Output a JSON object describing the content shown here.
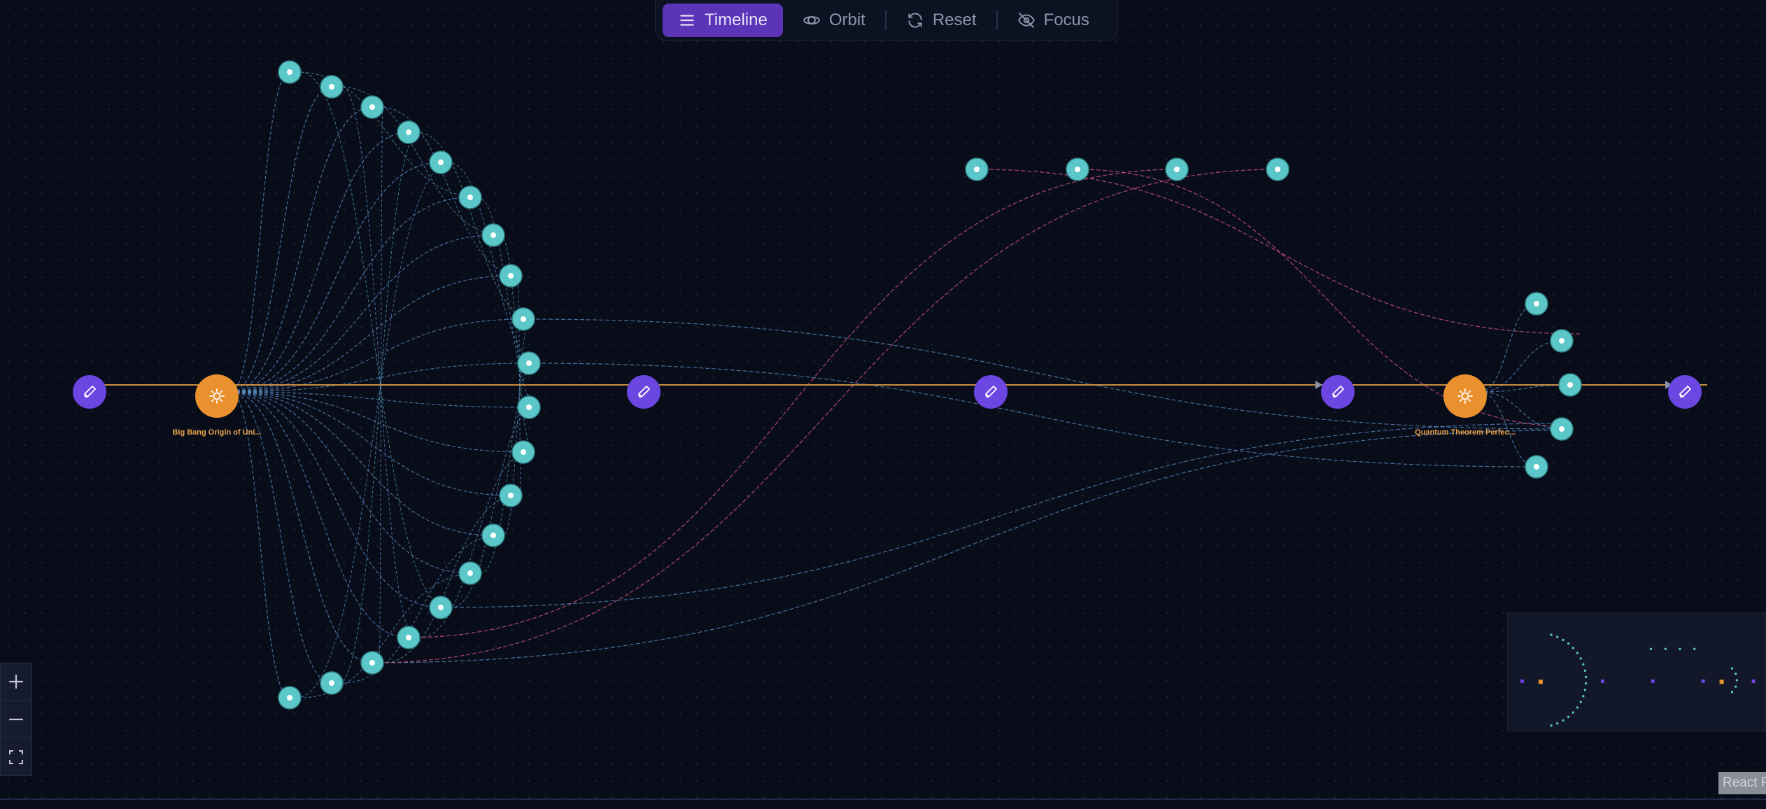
{
  "toolbar": {
    "timeline_label": "Timeline",
    "orbit_label": "Orbit",
    "reset_label": "Reset",
    "focus_label": "Focus"
  },
  "graph": {
    "event_labels": [
      "Big Bang Origin of Uni...",
      "Quantum Theorem Perfec..."
    ],
    "colors": {
      "background": "#090d1a",
      "timeline_edge": "#e9a34a",
      "edit_node": "#6b46e0",
      "event_node": "#e8912e",
      "leaf_node": "#5cc7c9",
      "blue_edge": "#5b8fc9",
      "pink_edge": "#d6548a"
    }
  },
  "zoom": {
    "zoom_in": "+",
    "zoom_out": "−",
    "fit": "fit-view"
  },
  "attribution": {
    "text": "React F"
  }
}
